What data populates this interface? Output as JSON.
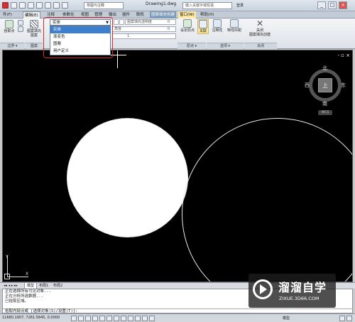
{
  "titlebar": {
    "workspace": "草图与注释",
    "doc_title": "Drawing1.dwg",
    "search_placeholder": "键入关键字或短语",
    "login": "登录",
    "win_min": "_",
    "win_max": "□",
    "win_close": "×"
  },
  "tabs": [
    {
      "label": "件(F)"
    },
    {
      "label": "编辑(E)"
    },
    {
      "label": "注释"
    },
    {
      "label": "参数化"
    },
    {
      "label": "视图"
    },
    {
      "label": "管理"
    },
    {
      "label": "输出"
    },
    {
      "label": "插件"
    },
    {
      "label": "联机"
    },
    {
      "label": "图案填充创建"
    },
    {
      "label": "窗口(W)"
    },
    {
      "label": "帮助(H)"
    }
  ],
  "ribbon": {
    "pick_points": "拾取点",
    "hatch_pattern": "图案填充图案",
    "hatch_transparency": "图案填充透明度",
    "transparency_value": "0",
    "angle_label": "角度",
    "angle_value": "0",
    "scale_value": "1",
    "set_origin": "设定原点",
    "associative": "关联",
    "annotative": "注释性",
    "match_properties": "特性匹配",
    "close_label": "关闭",
    "close_sub": "图案填充创建",
    "panels": {
      "boundary": "边界 ▾",
      "pattern": "图案",
      "origin": "原点 ▾",
      "options": "选项 ▾",
      "close": "关闭"
    }
  },
  "hatch_type": {
    "selected": "实体",
    "options": [
      "实体",
      "渐变色",
      "图案",
      "用户定义"
    ]
  },
  "viewcube": {
    "top": "上",
    "north": "北",
    "south": "南",
    "east": "东",
    "west": "西",
    "wcs": "WCS"
  },
  "viewport_ctrl": "- ▫ ×",
  "ucs": {
    "x": "X",
    "y": "Y"
  },
  "layout_tabs": [
    "模型",
    "布局1",
    "布局2"
  ],
  "command": {
    "lines": [
      "正在选择所有可见对象...",
      "正在分析所选数据...",
      "已拾取区域。"
    ],
    "prompt": "拾取内部点或 [选择对象(S)/设置(T)]:"
  },
  "status": {
    "coords": "11680.1907, 7261.5845, 0.0000",
    "model": "模型"
  },
  "watermark": {
    "title": "溜溜自学",
    "sub": "ZIXUE.3D66.COM"
  }
}
